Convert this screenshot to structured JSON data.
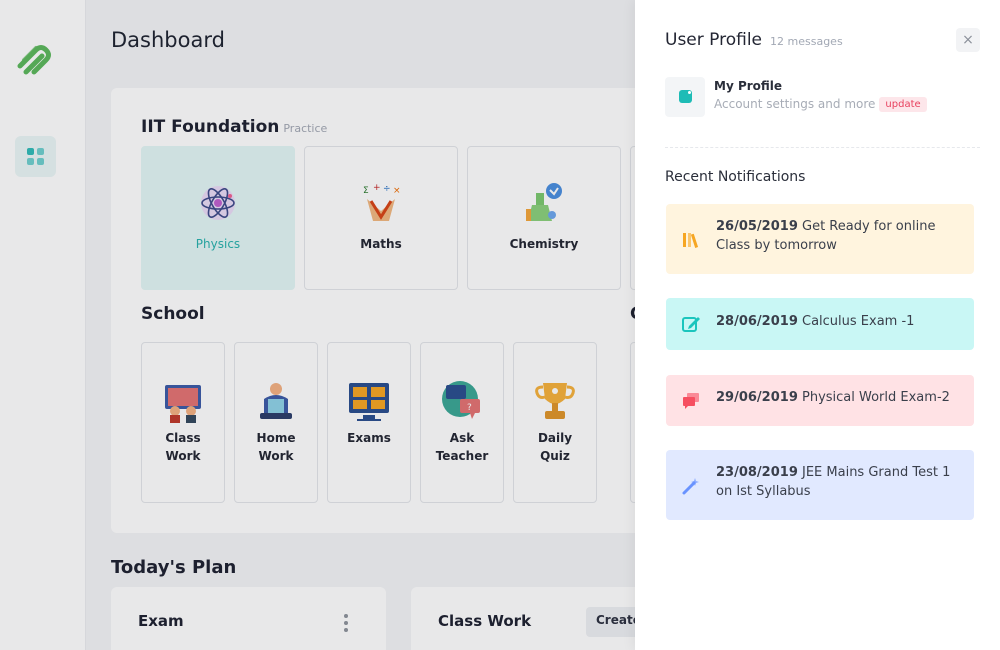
{
  "main": {
    "page_title": "Dashboard",
    "iit": {
      "heading": "IIT Foundation",
      "subheading": "Practice",
      "subjects": [
        {
          "label": "Physics",
          "icon": "atom-icon"
        },
        {
          "label": "Maths",
          "icon": "math-symbols-icon"
        },
        {
          "label": "Chemistry",
          "icon": "flask-icon"
        }
      ]
    },
    "school": {
      "heading": "School",
      "items": [
        {
          "line1": "Class",
          "line2": "Work",
          "icon": "classroom-icon"
        },
        {
          "line1": "Home",
          "line2": "Work",
          "icon": "home-study-icon"
        },
        {
          "line1": "Exams",
          "line2": "",
          "icon": "exam-screen-icon"
        },
        {
          "line1": "Ask",
          "line2": "Teacher",
          "icon": "chat-bubbles-icon"
        },
        {
          "line1": "Daily",
          "line2": "Quiz",
          "icon": "trophy-icon"
        }
      ]
    },
    "plan": {
      "heading": "Today's Plan",
      "cards": [
        {
          "title": "Exam"
        },
        {
          "title": "Class Work",
          "button": "Create"
        }
      ]
    }
  },
  "panel": {
    "title": "User Profile",
    "subtitle": "12 messages",
    "close_glyph": "×",
    "profile": {
      "name": "My Profile",
      "description": "Account settings and more",
      "badge": "update"
    },
    "notifications_heading": "Recent Notifications",
    "notifications": [
      {
        "date": "26/05/2019",
        "text": "Get Ready for online Class by tomorrow",
        "bg": "#fff4de",
        "accent": "#f6a623",
        "icon": "books-icon"
      },
      {
        "date": "28/06/2019",
        "text": "Calculus Exam -1",
        "bg": "#c9f7f5",
        "accent": "#1bc5bd",
        "icon": "edit-icon"
      },
      {
        "date": "29/06/2019",
        "text": "Physical World Exam-2",
        "bg": "#ffe2e5",
        "accent": "#f64e60",
        "icon": "chat-icon"
      },
      {
        "date": "23/08/2019",
        "text": "JEE Mains Grand Test 1 on Ist Syllabus",
        "bg": "#e1e9ff",
        "accent": "#6993ff",
        "icon": "wand-icon"
      }
    ]
  },
  "colors": {
    "brand": "#5cb85c",
    "teal": "#1ebcb6"
  }
}
